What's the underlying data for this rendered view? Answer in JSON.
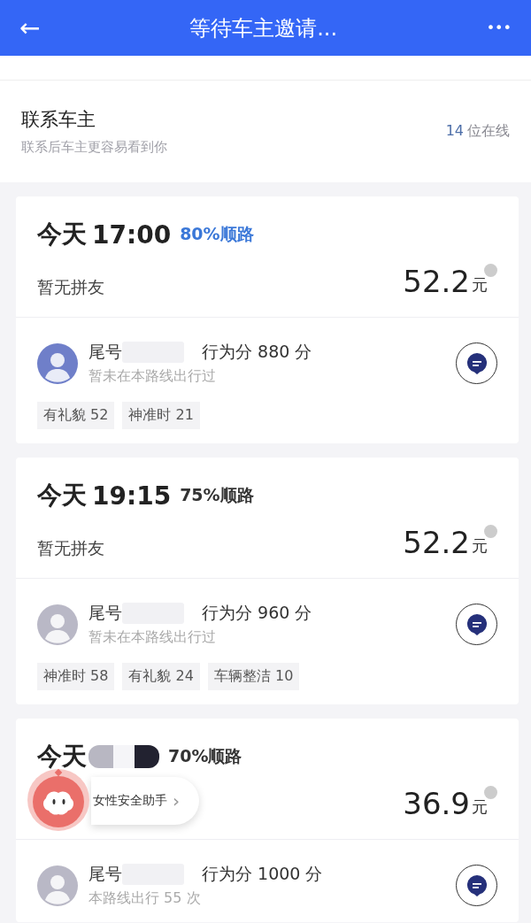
{
  "header": {
    "title": "等待车主邀请...",
    "back": "←",
    "more": "•••"
  },
  "contact": {
    "title": "联系车主",
    "subtitle": "联系后车主更容易看到你",
    "online_count": "14",
    "online_label": "位在线"
  },
  "trips": [
    {
      "day": "今天",
      "time": "17:00",
      "time_redacted": false,
      "match": "80%顺路",
      "match_highlighted": true,
      "companions": "暂无拼友",
      "price": "52.2",
      "unit": "元",
      "driver": {
        "plate_label": "尾号",
        "score": "行为分 880 分",
        "history": "暂未在本路线出行过",
        "avatar": {
          "color": "#6f7fc9"
        },
        "tags": [
          "有礼貌 52",
          "神准时 21"
        ]
      }
    },
    {
      "day": "今天",
      "time": "19:15",
      "time_redacted": false,
      "match": "75%顺路",
      "match_highlighted": false,
      "companions": "暂无拼友",
      "price": "52.2",
      "unit": "元",
      "driver": {
        "plate_label": "尾号",
        "score": "行为分 960 分",
        "history": "暂未在本路线出行过",
        "avatar": {
          "color": "#b9b8c6"
        },
        "tags": [
          "神准时 58",
          "有礼貌 24",
          "车辆整洁 10"
        ]
      }
    },
    {
      "day": "今天",
      "time_redacted": true,
      "match": "70%顺路",
      "match_highlighted": false,
      "price": "36.9",
      "unit": "元",
      "driver": {
        "plate_label": "尾号",
        "score": "行为分 1000 分",
        "history": "本路线出行 55 次",
        "avatar": {
          "color": "#b9b8c6"
        }
      }
    }
  ],
  "safety_assistant": {
    "label": "女性安全助手",
    "chevron": "›"
  }
}
